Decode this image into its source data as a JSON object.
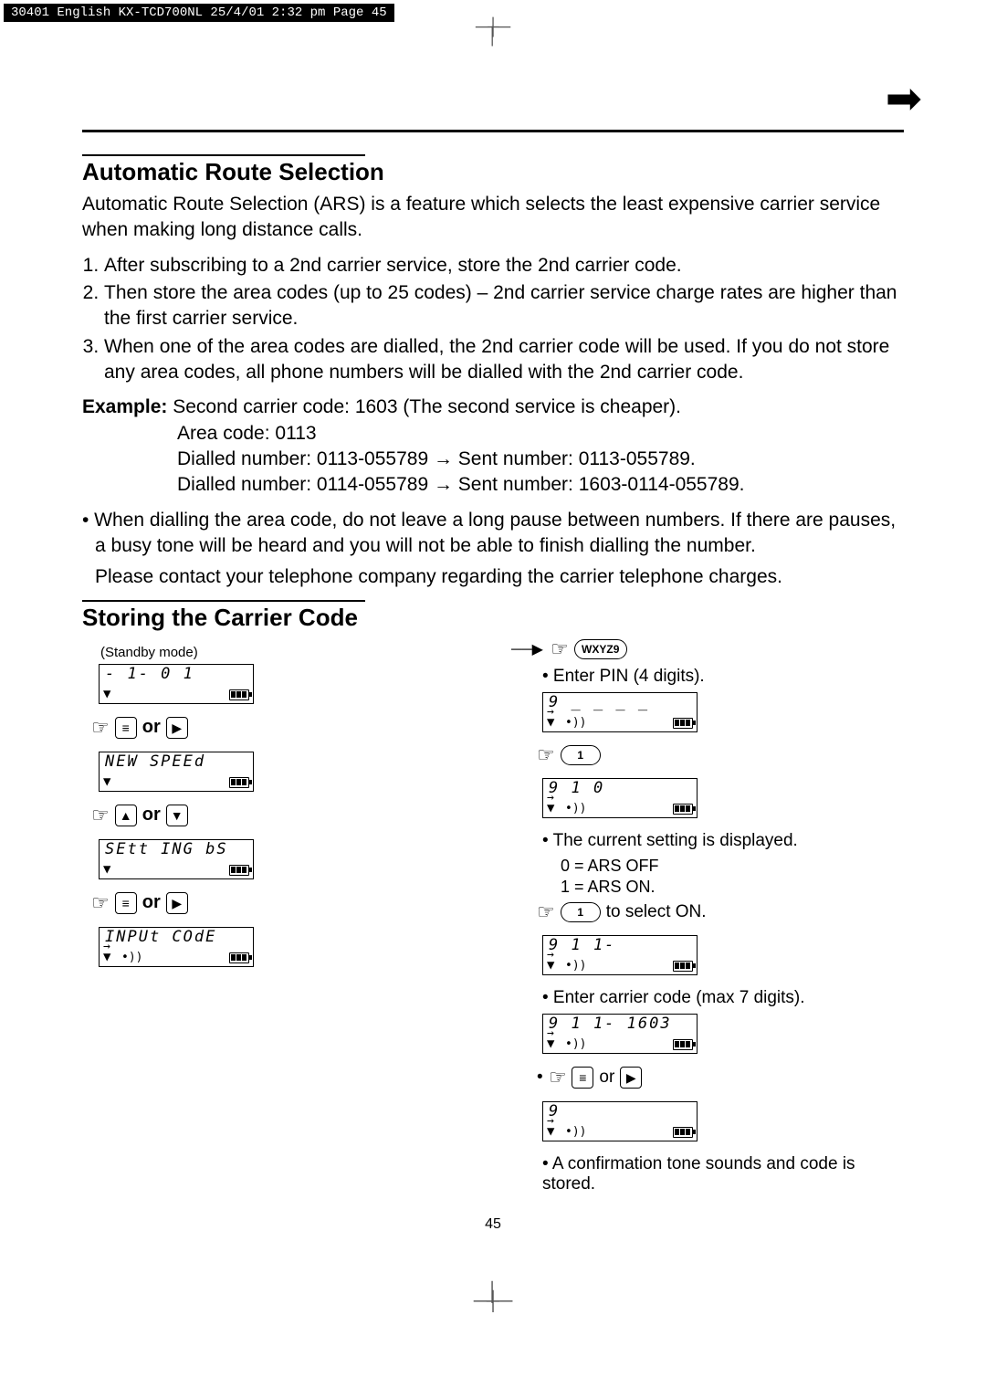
{
  "print_header": "30401 English KX-TCD700NL  25/4/01  2:32 pm  Page 45",
  "section1": {
    "title": "Automatic Route Selection",
    "intro": "Automatic Route Selection (ARS) is a feature which selects the least expensive carrier service when making long distance calls.",
    "step1": "After subscribing to a 2nd carrier service, store the 2nd carrier code.",
    "step2": "Then store the area codes (up to 25 codes) – 2nd carrier service charge rates are higher than the first carrier service.",
    "step3": "When one of the area codes are dialled, the 2nd carrier code will be used. If you do not store any area codes, all phone numbers will be dialled with the 2nd carrier code.",
    "example_label": "Example:",
    "example_l1": "Second carrier code: 1603 (The second service is cheaper).",
    "example_l2": "Area code: 0113",
    "example_l3": "Dialled number: 0113-055789 → Sent number: 0113-055789.",
    "example_l4": "Dialled number: 0114-055789 → Sent number: 1603-0114-055789.",
    "bullet": "• When dialling the area code, do not leave a long pause between numbers. If there are pauses, a busy tone will be heard and you will not be able to finish dialling the number.",
    "note": "Please contact your telephone company regarding the carrier telephone charges."
  },
  "section2": {
    "title": "Storing the Carrier Code",
    "standby": "(Standby mode)",
    "lcd1": "- 1-          0 1",
    "or": "or",
    "lcd2": "NEW SPEEd",
    "lcd3": "SEtt ING bS",
    "lcd4": "INPUt COdE",
    "press9": "WXYZ9",
    "enter_pin": "• Enter PIN (4 digits).",
    "lcd5": "9  _ _ _ _",
    "press1": "1",
    "lcd6": "9 1  0",
    "current_setting": "• The current setting is displayed.",
    "ars_off": "0 = ARS OFF",
    "ars_on": "1 = ARS ON.",
    "press1_on": " to select ON.",
    "lcd7": "9 1   1-",
    "enter_carrier": "• Enter carrier code (max 7 digits).",
    "lcd8": "9 1   1- 1603",
    "lcd9": "9",
    "confirm": "• A confirmation tone sounds and code is stored.",
    "dot_or": "or"
  },
  "page_number": "45"
}
